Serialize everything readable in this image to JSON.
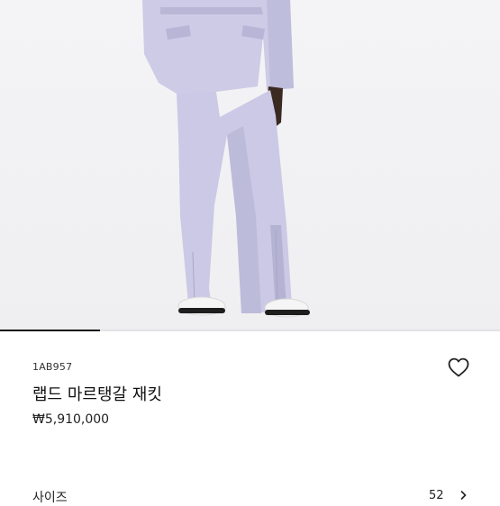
{
  "product": {
    "sku": "1AB957",
    "name": "랩드 마르탱갈 재킷",
    "price": "₩5,910,000",
    "image_alt": "lavender-suit-model-photo"
  },
  "gallery": {
    "progress_fraction": 0.2
  },
  "size_selector": {
    "label": "사이즈",
    "value": "52"
  },
  "icons": {
    "wishlist": "heart-icon",
    "size_chevron": "chevron-right-icon"
  },
  "colors": {
    "suit": "#c9c7e3",
    "skin": "#3a2a22",
    "shoes": "#f2f2f2",
    "accent": "#111111"
  }
}
